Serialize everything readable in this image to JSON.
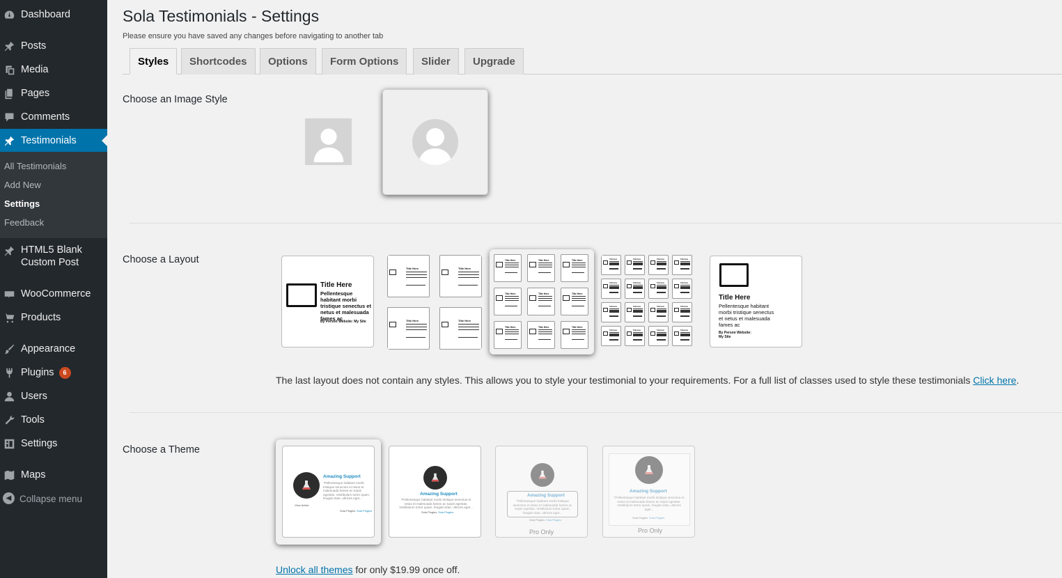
{
  "sidebar": {
    "items": [
      {
        "label": "Dashboard",
        "icon": "dashboard-icon"
      },
      {
        "label": "Posts",
        "icon": "pin-icon"
      },
      {
        "label": "Media",
        "icon": "media-icon"
      },
      {
        "label": "Pages",
        "icon": "pages-icon"
      },
      {
        "label": "Comments",
        "icon": "comment-icon"
      },
      {
        "label": "Testimonials",
        "icon": "pin-icon"
      },
      {
        "label": "HTML5 Blank Custom Post",
        "icon": "pin-icon"
      },
      {
        "label": "WooCommerce",
        "icon": "woo-icon"
      },
      {
        "label": "Products",
        "icon": "cart-icon"
      },
      {
        "label": "Appearance",
        "icon": "brush-icon"
      },
      {
        "label": "Plugins",
        "icon": "plug-icon",
        "badge": "6"
      },
      {
        "label": "Users",
        "icon": "user-icon"
      },
      {
        "label": "Tools",
        "icon": "wrench-icon"
      },
      {
        "label": "Settings",
        "icon": "settings-icon"
      },
      {
        "label": "Maps",
        "icon": "map-icon"
      }
    ],
    "submenu": [
      "All Testimonials",
      "Add New",
      "Settings",
      "Feedback"
    ],
    "collapse_label": "Collapse menu"
  },
  "page": {
    "title": "Sola Testimonials - Settings",
    "note": "Please ensure you have saved any changes before navigating to another tab"
  },
  "tabs": [
    "Styles",
    "Shortcodes",
    "Options",
    "Form Options",
    "Slider",
    "Upgrade"
  ],
  "sections": {
    "image_style": "Choose an Image Style",
    "layout": "Choose a Layout",
    "theme": "Choose a Theme"
  },
  "layout_preview": {
    "title": "Title Here",
    "body": "Pellentesque habitant morbi tristique senectus et netus et malesuada fames ac",
    "byline": "By Person Website: My Site"
  },
  "layout_note": {
    "text": "The last layout does not contain any styles. This allows you to style your testimonial to your requirements. For a full list of classes used to style these testimonials ",
    "link": "Click here",
    "end": "."
  },
  "theme_preview": {
    "title": "Amazing Support",
    "body": "\"Pellentesque habitant morbi tristique senectus et netus et malesuada fames ac turpis egestas. Vestibulum tortor quam, feugiat vitae, ultrices eget...",
    "view": "View Article",
    "author": "Sola Plugins",
    "site": "Sola Plugins",
    "pro_only": "Pro Only"
  },
  "unlock": {
    "link": "Unlock all themes",
    "text": " for only $19.99 once off."
  },
  "colors": {
    "sidebar_bg": "#23282d",
    "active": "#0073aa",
    "badge": "#ca4a1f",
    "link": "#0073aa"
  }
}
